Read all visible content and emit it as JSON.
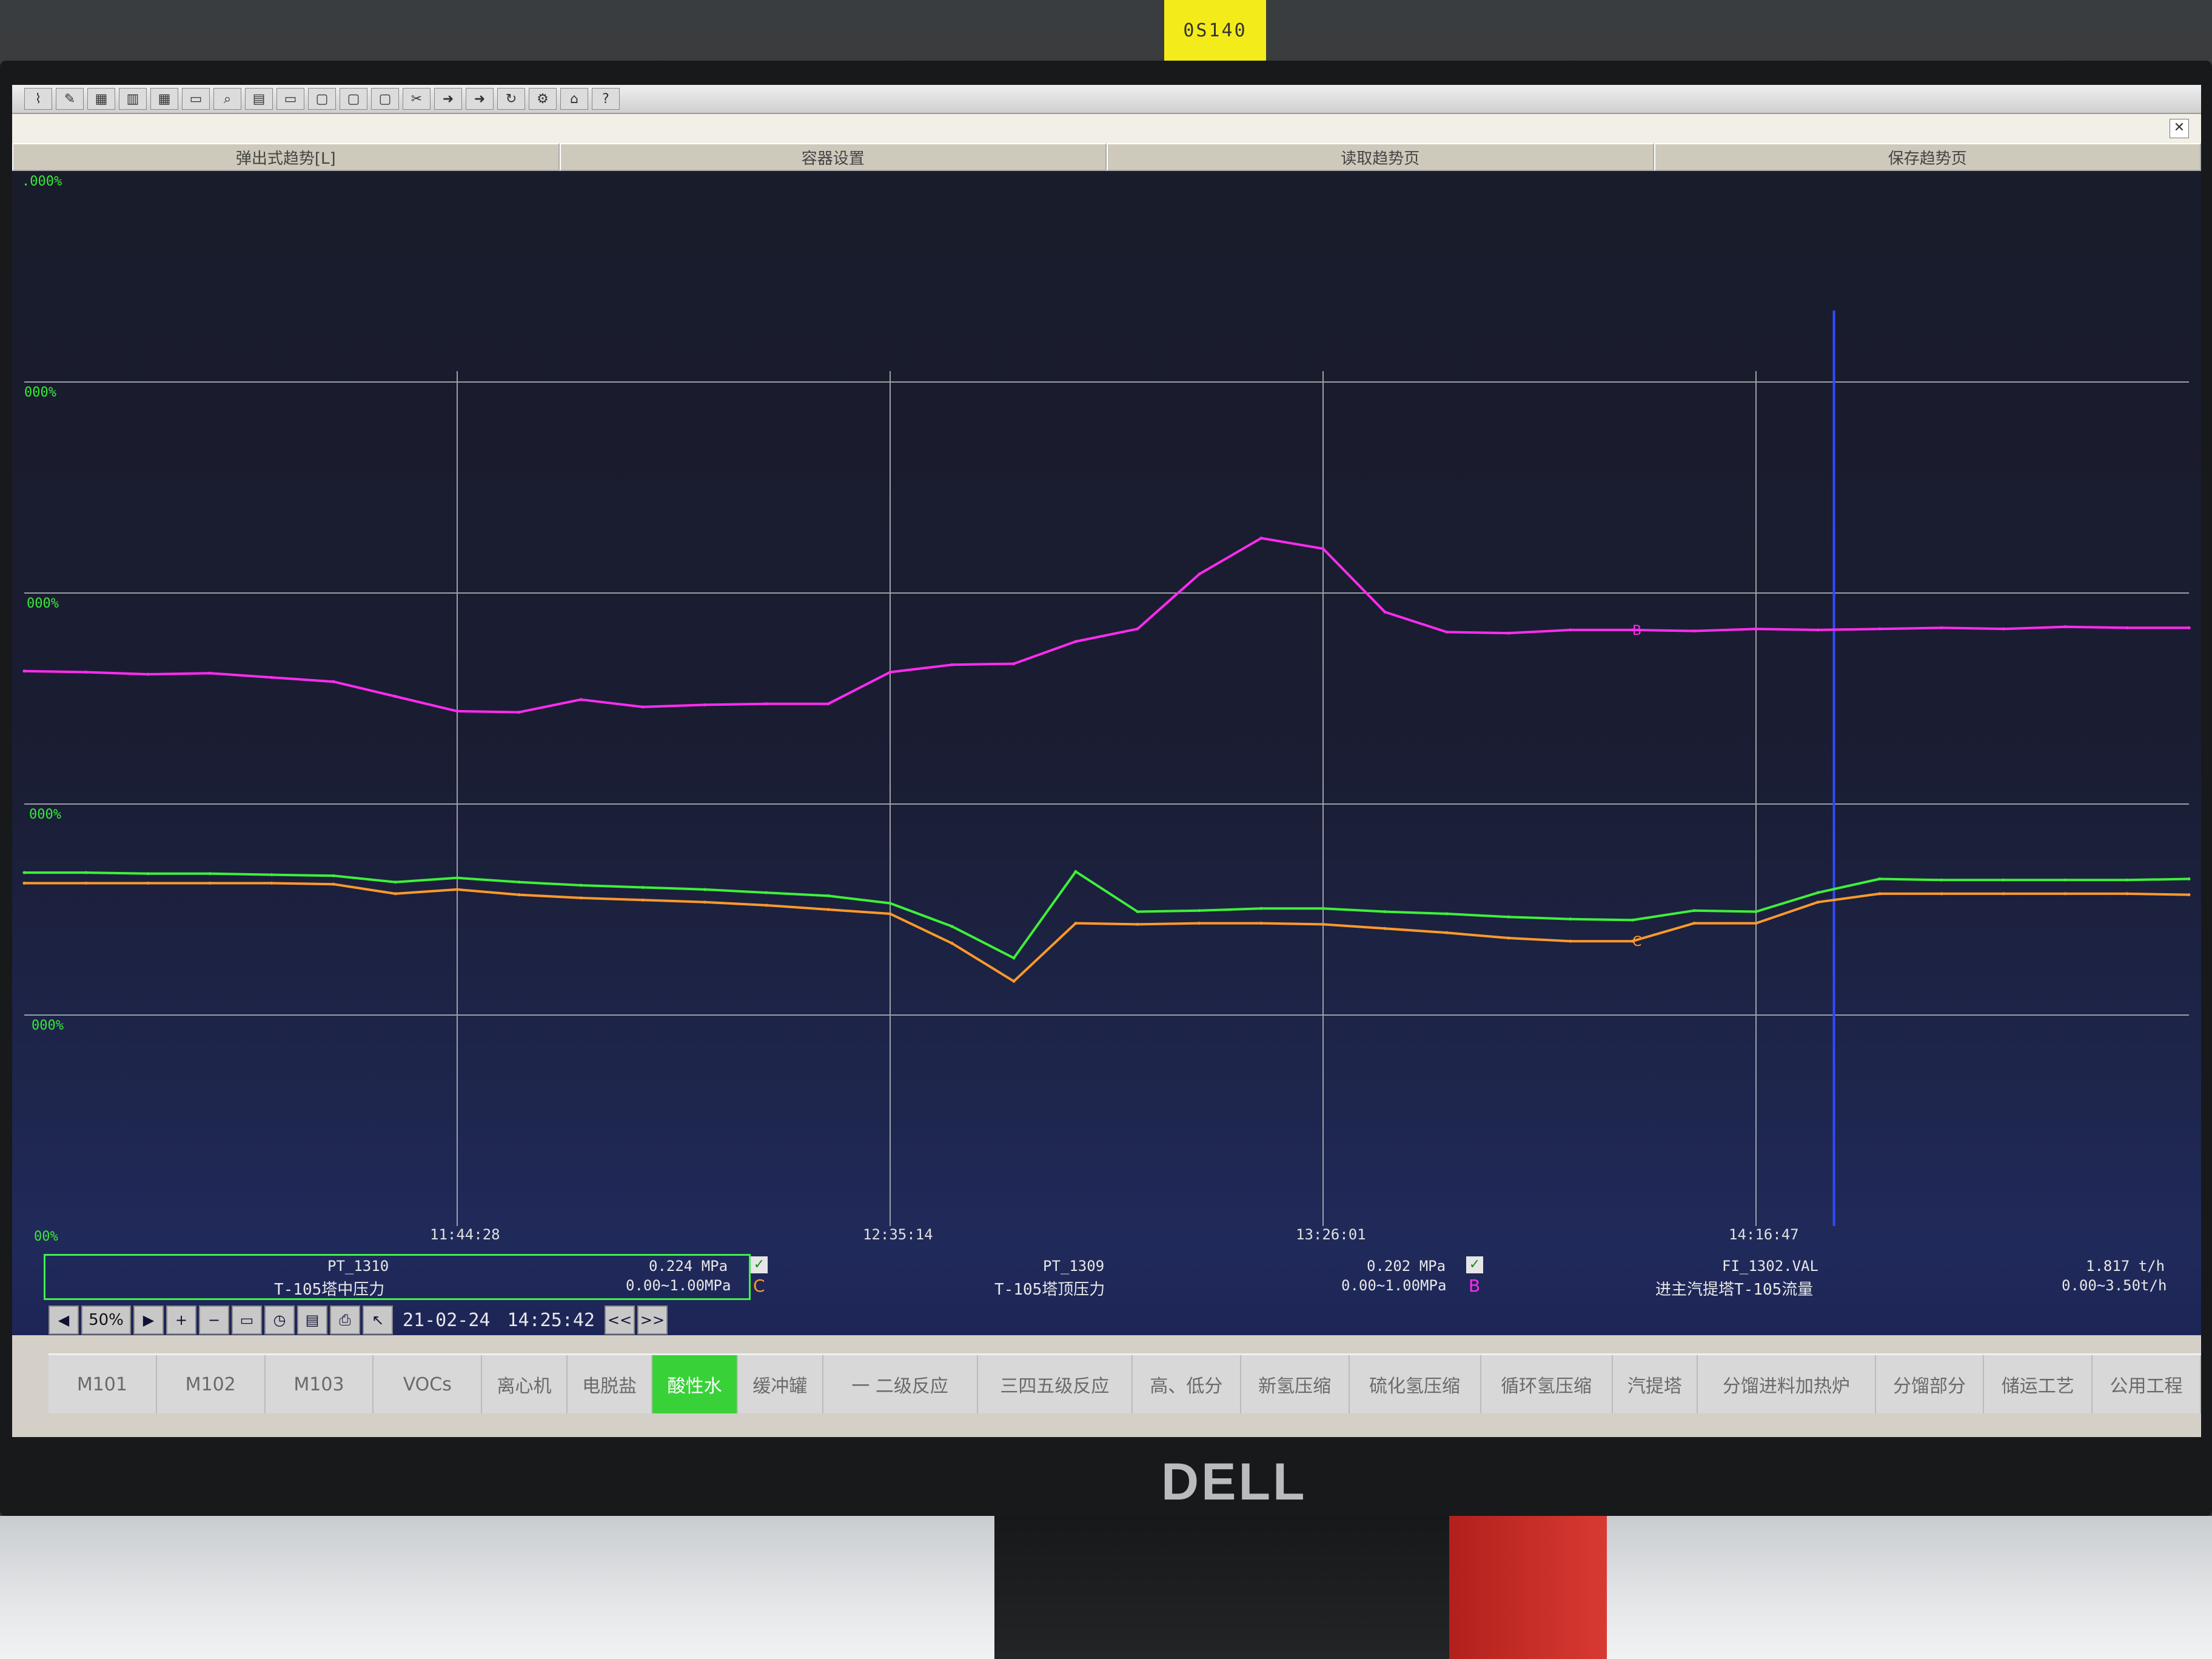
{
  "monitor": {
    "brand": "DELL",
    "sticker": "0S140"
  },
  "window": {
    "tabs": [
      "弹出式趋势[L]",
      "容器设置",
      "读取趋势页",
      "保存趋势页"
    ],
    "close_label": "✕",
    "toolbar_icons": [
      "trend-icon",
      "pen-icon",
      "grid-icon",
      "bars-icon",
      "grid-icon",
      "monitor-icon",
      "zoom-icon",
      "chart-icon",
      "monitor-icon",
      "folder-icon",
      "folder-icon",
      "folder-icon",
      "cut-icon",
      "arrow-icon",
      "arrow-icon",
      "refresh-icon",
      "settings-icon",
      "home-icon",
      "help-icon"
    ]
  },
  "chart_data": {
    "type": "line",
    "y_tick_labels": [
      ".000%",
      "000%",
      "000%",
      "000%",
      "000%",
      "00%"
    ],
    "x_tick_labels": [
      "11:44:28",
      "12:35:14",
      "13:26:01",
      "14:16:47"
    ],
    "cursor_time_index": 3.18,
    "series": [
      {
        "color": "#ff2cf0",
        "marker": "B",
        "values": [
          52.6,
          52.5,
          52.3,
          52.4,
          52.0,
          51.6,
          50.2,
          48.8,
          48.7,
          49.9,
          49.2,
          49.4,
          49.5,
          49.5,
          52.5,
          53.2,
          53.3,
          55.4,
          56.6,
          61.8,
          65.2,
          64.2,
          58.2,
          56.3,
          56.2,
          56.5,
          56.5,
          56.4,
          56.6,
          56.5,
          56.6,
          56.7,
          56.6,
          56.8,
          56.7,
          56.7
        ]
      },
      {
        "color": "#3ef03a",
        "marker": "",
        "values": [
          33.5,
          33.5,
          33.4,
          33.4,
          33.3,
          33.2,
          32.6,
          33.0,
          32.6,
          32.3,
          32.1,
          31.9,
          31.6,
          31.3,
          30.6,
          28.4,
          25.4,
          33.6,
          29.8,
          29.9,
          30.1,
          30.1,
          29.8,
          29.6,
          29.3,
          29.1,
          29.0,
          29.9,
          29.8,
          31.6,
          32.9,
          32.8,
          32.8,
          32.8,
          32.8,
          32.9
        ]
      },
      {
        "color": "#ff9a2a",
        "marker": "C",
        "values": [
          32.5,
          32.5,
          32.5,
          32.5,
          32.5,
          32.4,
          31.5,
          31.9,
          31.4,
          31.1,
          30.9,
          30.7,
          30.4,
          30.0,
          29.6,
          26.8,
          23.2,
          28.7,
          28.6,
          28.7,
          28.7,
          28.6,
          28.2,
          27.8,
          27.3,
          27.0,
          27.0,
          28.7,
          28.7,
          30.7,
          31.5,
          31.5,
          31.5,
          31.5,
          31.5,
          31.4
        ]
      }
    ],
    "pens": [
      {
        "tag": "PT_1310",
        "desc": "T-105塔中压力",
        "value": "0.224 MPa",
        "range": "0.00~1.00MPa",
        "letter": "C",
        "color": "#ff9a2a",
        "checked": true,
        "selected": true
      },
      {
        "tag": "PT_1309",
        "desc": "T-105塔顶压力",
        "value": "0.202 MPa",
        "range": "0.00~1.00MPa",
        "letter": "B",
        "color": "#ff2cf0",
        "checked": true,
        "selected": false
      },
      {
        "tag": "FI_1302.VAL",
        "desc": "进主汽提塔T-105流量",
        "value": "1.817 t/h",
        "range": "0.00~3.50t/h",
        "letter": "",
        "color": "#3ef03a",
        "checked": false,
        "selected": false
      }
    ]
  },
  "nav": {
    "zoom": "50%",
    "date": "21-02-24",
    "time": "14:25:42",
    "check_mark": "✓",
    "buttons": {
      "back": "◀",
      "forward": "▶",
      "zoom_in": "+",
      "zoom_out": "−",
      "page": "▭",
      "clock": "◷",
      "print_page": "▤",
      "print": "⎙",
      "select": "↖",
      "prev": "<<",
      "next": ">>"
    }
  },
  "bottom_nav": [
    {
      "label": "M101",
      "active": false
    },
    {
      "label": "M102",
      "active": false
    },
    {
      "label": "M103",
      "active": false
    },
    {
      "label": "VOCs",
      "active": false
    },
    {
      "label": "离心机",
      "active": false
    },
    {
      "label": "电脱盐",
      "active": false
    },
    {
      "label": "酸性水",
      "active": true
    },
    {
      "label": "缓冲罐",
      "active": false
    },
    {
      "label": "一 二级反应",
      "active": false
    },
    {
      "label": "三四五级反应",
      "active": false
    },
    {
      "label": "高、低分",
      "active": false
    },
    {
      "label": "新氢压缩",
      "active": false
    },
    {
      "label": "硫化氢压缩",
      "active": false
    },
    {
      "label": "循环氢压缩",
      "active": false
    },
    {
      "label": "汽提塔",
      "active": false
    },
    {
      "label": "分馏进料加热炉",
      "active": false
    },
    {
      "label": "分馏部分",
      "active": false
    },
    {
      "label": "储运工艺",
      "active": false
    },
    {
      "label": "公用工程",
      "active": false
    }
  ]
}
